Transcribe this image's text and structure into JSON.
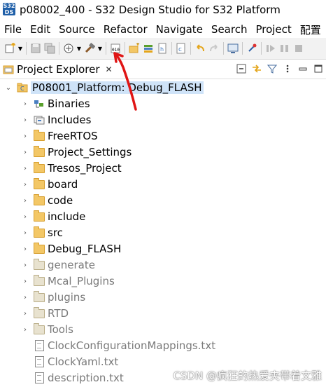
{
  "window": {
    "icon_text": "S32\nDS",
    "title": "p08002_400 - S32 Design Studio for S32 Platform"
  },
  "menu": [
    "File",
    "Edit",
    "Source",
    "Refactor",
    "Navigate",
    "Search",
    "Project",
    "配置"
  ],
  "toolbar_icons": [
    "new-icon",
    "dropdown-arrow-icon",
    "save-icon",
    "save-all-icon",
    "debug-config-icon",
    "dropdown-arrow-icon",
    "build-hammer-icon",
    "dropdown-arrow-icon",
    "binary-icon",
    "new-folder-icon",
    "new-class-icon",
    "new-file-icon",
    "search-icon",
    "undo-icon",
    "redo-icon",
    "terminal-icon",
    "pin-icon",
    "play-icon",
    "step-icon",
    "stop-icon"
  ],
  "view": {
    "tab_label": "Project Explorer",
    "close_symbol": "✕",
    "tools": [
      "collapse-all-icon",
      "link-editor-icon",
      "filter-icon",
      "view-menu-icon",
      "minimize-icon",
      "maximize-icon"
    ]
  },
  "tree": {
    "root": {
      "label": "P08001_Platform: Debug_FLASH",
      "expanded": true
    },
    "children": [
      {
        "label": "Binaries",
        "icon": "binaries-icon",
        "derived": false
      },
      {
        "label": "Includes",
        "icon": "includes-icon",
        "derived": false
      },
      {
        "label": "FreeRTOS",
        "icon": "folder-icon",
        "derived": false
      },
      {
        "label": "Project_Settings",
        "icon": "folder-icon",
        "derived": false
      },
      {
        "label": "Tresos_Project",
        "icon": "folder-icon",
        "derived": false
      },
      {
        "label": "board",
        "icon": "folder-icon",
        "derived": false
      },
      {
        "label": "code",
        "icon": "folder-icon",
        "derived": false
      },
      {
        "label": "include",
        "icon": "folder-icon",
        "derived": false
      },
      {
        "label": "src",
        "icon": "folder-icon",
        "derived": false
      },
      {
        "label": "Debug_FLASH",
        "icon": "folder-icon",
        "derived": false
      },
      {
        "label": "generate",
        "icon": "folder-icon",
        "derived": true
      },
      {
        "label": "Mcal_Plugins",
        "icon": "folder-icon",
        "derived": true
      },
      {
        "label": "plugins",
        "icon": "folder-icon",
        "derived": true
      },
      {
        "label": "RTD",
        "icon": "folder-icon",
        "derived": true
      },
      {
        "label": "Tools",
        "icon": "folder-icon",
        "derived": true
      },
      {
        "label": "ClockConfigurationMappings.txt",
        "icon": "file-icon",
        "derived": true
      },
      {
        "label": "ClockYaml.txt",
        "icon": "file-icon",
        "derived": true
      },
      {
        "label": "description.txt",
        "icon": "file-icon",
        "derived": true
      }
    ]
  },
  "watermark": "CSDN @疯狂的热爱夹带着文雅",
  "colors": {
    "selection": "#cfe3f8",
    "annotation_arrow": "#e01515",
    "derived_text": "#7a7a7a"
  }
}
